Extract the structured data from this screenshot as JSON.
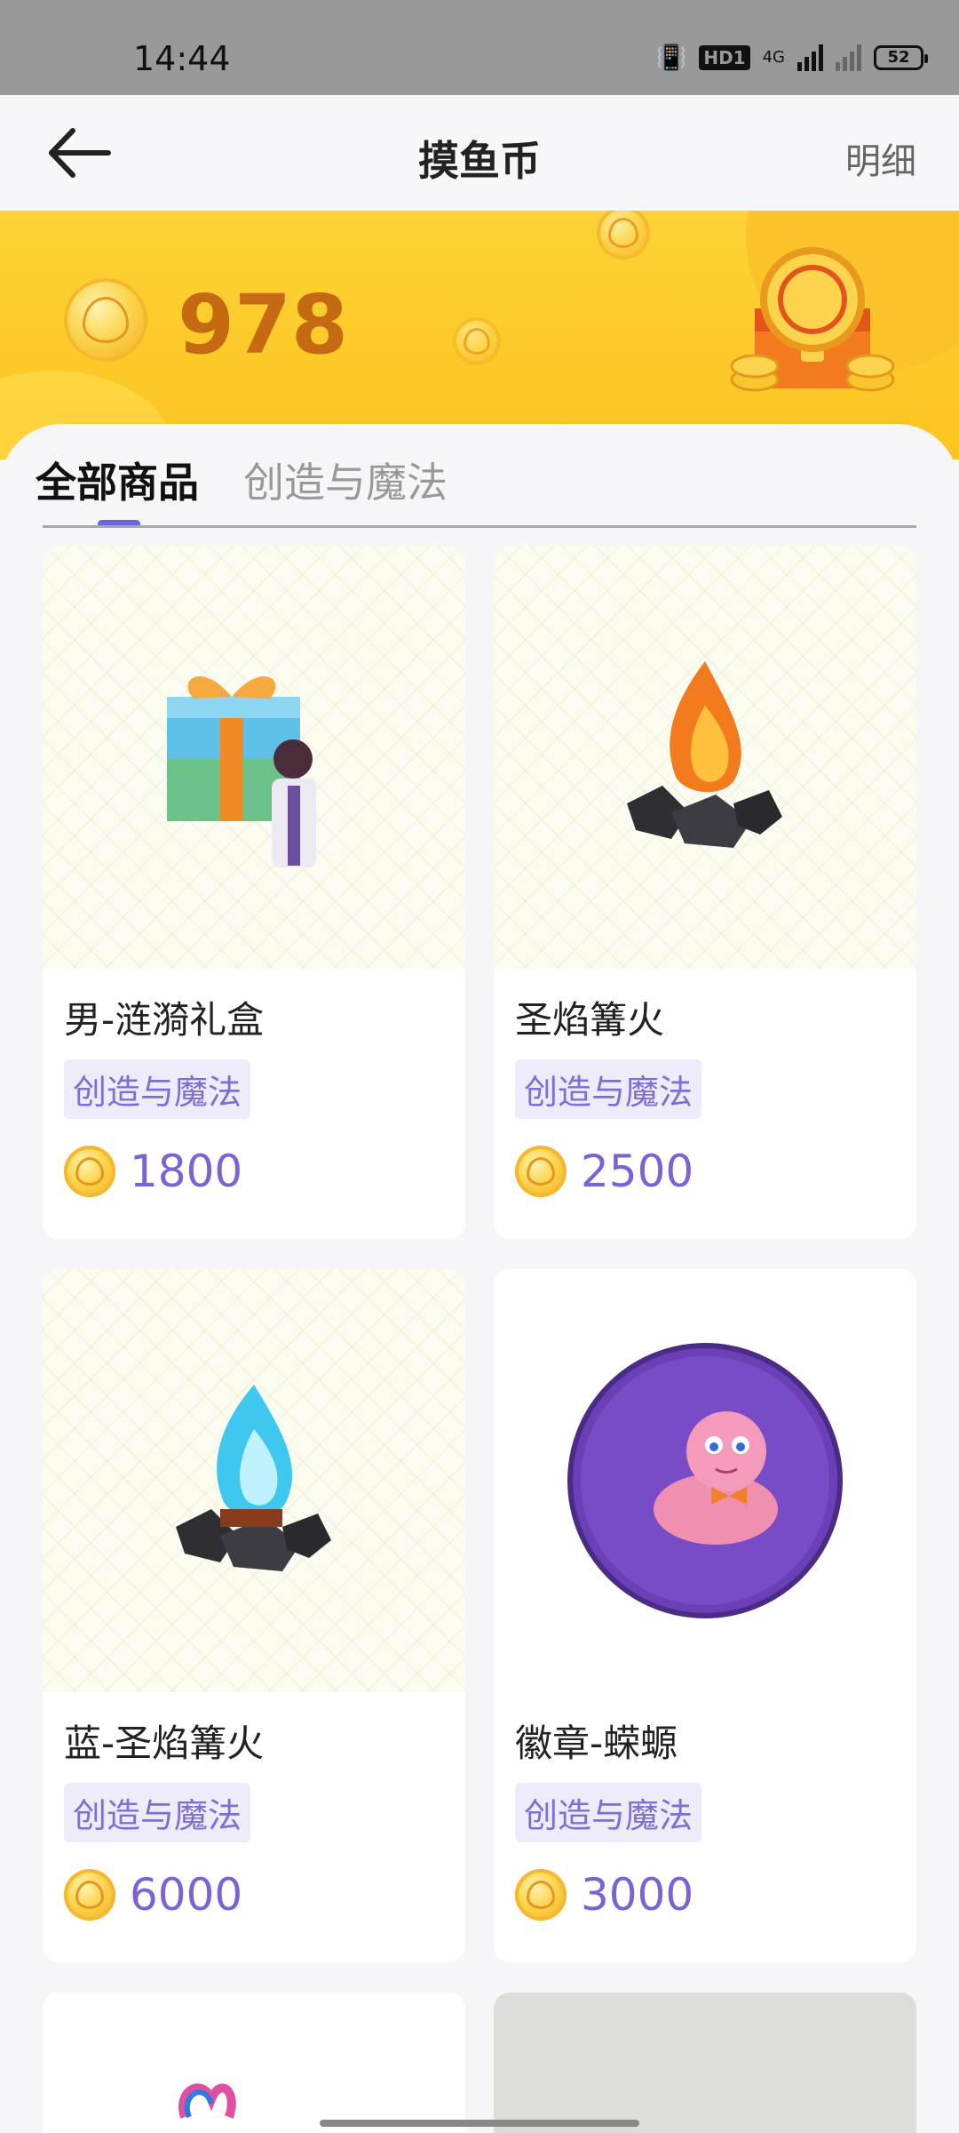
{
  "status_bar": {
    "time": "14:44",
    "hd_label": "HD1",
    "network_label": "4G",
    "battery": "52"
  },
  "header": {
    "title": "摸鱼币",
    "detail_link": "明细"
  },
  "balance": {
    "value": "978"
  },
  "tabs": [
    {
      "label": "全部商品",
      "active": true
    },
    {
      "label": "创造与魔法",
      "active": false
    }
  ],
  "products": [
    {
      "name": "男-涟漪礼盒",
      "tag": "创造与魔法",
      "price": "1800",
      "image": "gift-box-with-character"
    },
    {
      "name": "圣焰篝火",
      "tag": "创造与魔法",
      "price": "2500",
      "image": "orange-campfire"
    },
    {
      "name": "蓝-圣焰篝火",
      "tag": "创造与魔法",
      "price": "6000",
      "image": "blue-campfire"
    },
    {
      "name": "徽章-蝾螈",
      "tag": "创造与魔法",
      "price": "3000",
      "image": "axolotl-badge"
    }
  ],
  "colors": {
    "accent": "#6b63e0",
    "price": "#7d62d6",
    "banner": "#fcc41f",
    "balance": "#c56a13"
  }
}
